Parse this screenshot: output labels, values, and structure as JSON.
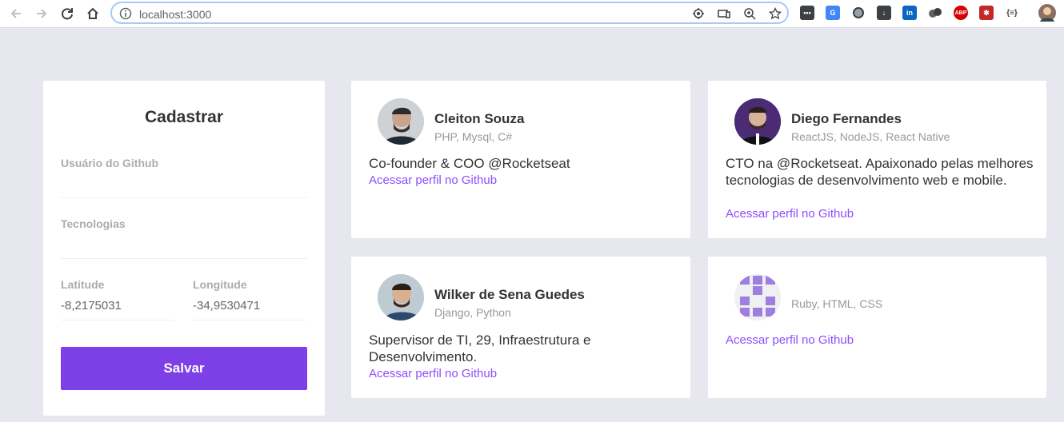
{
  "browser": {
    "url": "localhost:3000",
    "extensions": [
      {
        "name": "pinterest-style-extension-icon",
        "color": "#3c4043"
      },
      {
        "name": "google-translate-icon",
        "color": "#4285f4"
      },
      {
        "name": "circle-extension-icon",
        "color": "#5f6368"
      },
      {
        "name": "download-extension-icon",
        "color": "#3c4043"
      },
      {
        "name": "linkedin-icon",
        "color": "#0a66c2"
      },
      {
        "name": "multi-circle-extension-icon",
        "color": "#3c4043"
      },
      {
        "name": "adblock-plus-icon",
        "color": "#d40000"
      },
      {
        "name": "puzzle-red-extension-icon",
        "color": "#c62828"
      },
      {
        "name": "json-viewer-icon",
        "color": "#3c4043"
      }
    ],
    "ext_labels": {
      "linkedin": "in",
      "abp": "ABP",
      "json": "{≡}"
    }
  },
  "form": {
    "title": "Cadastrar",
    "github_user_label": "Usuário do Github",
    "github_user_value": "",
    "techs_label": "Tecnologias",
    "techs_value": "",
    "latitude_label": "Latitude",
    "latitude_value": "-8,2175031",
    "longitude_label": "Longitude",
    "longitude_value": "-34,9530471",
    "save_label": "Salvar"
  },
  "devs": [
    {
      "name": "Cleiton Souza",
      "techs": "PHP, Mysql, C#",
      "bio": "Co-founder & COO @Rocketseat",
      "link": "Acessar perfil no Github"
    },
    {
      "name": "Diego Fernandes",
      "techs": "ReactJS, NodeJS, React Native",
      "bio": "CTO na @Rocketseat. Apaixonado pelas melhores tecnologias de desenvolvimento web e mobile.",
      "link": "Acessar perfil no Github"
    },
    {
      "name": "Wilker de Sena Guedes",
      "techs": "Django, Python",
      "bio": "Supervisor de TI, 29, Infraestrutura e Desenvolvimento.",
      "link": "Acessar perfil no Github"
    },
    {
      "name": "",
      "techs": "Ruby, HTML, CSS",
      "bio": "",
      "link": "Acessar perfil no Github"
    }
  ],
  "colors": {
    "accent": "#7d40e7",
    "link": "#8e4dff",
    "background": "#e7e7ef"
  }
}
